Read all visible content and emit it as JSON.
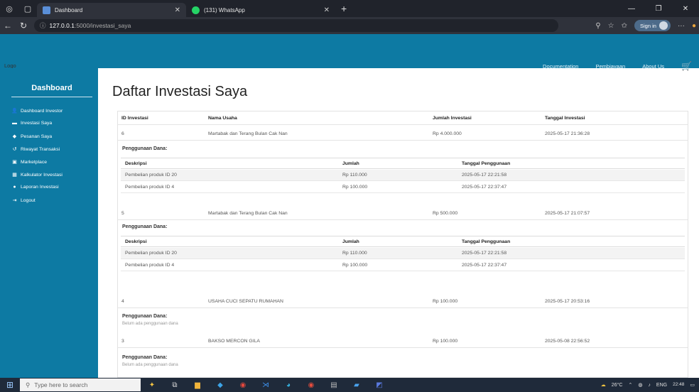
{
  "browser": {
    "tabs": [
      {
        "title": "Dashboard",
        "active": true
      },
      {
        "title": "(131) WhatsApp",
        "active": false
      }
    ],
    "url_host": "127.0.0.1",
    "url_path": ":5000/investasi_saya",
    "signin_label": "Sign in"
  },
  "navbar": {
    "logo": "Logo",
    "links": [
      "Documentation",
      "Pembiayaan",
      "About Us"
    ]
  },
  "sidebar": {
    "title": "Dashboard",
    "items": [
      {
        "label": "Dashboard Investor",
        "icon": "user-icon"
      },
      {
        "label": "Investasi Saya",
        "icon": "card-icon"
      },
      {
        "label": "Pesanan Saya",
        "icon": "box-icon"
      },
      {
        "label": "Riwayat Transaksi",
        "icon": "history-icon"
      },
      {
        "label": "Marketplace",
        "icon": "shop-icon"
      },
      {
        "label": "Kalkulator Investasi",
        "icon": "calculator-icon"
      },
      {
        "label": "Laporan Investasi",
        "icon": "chart-icon"
      },
      {
        "label": "Logout",
        "icon": "logout-icon"
      }
    ]
  },
  "page": {
    "title": "Daftar Investasi Saya",
    "columns": [
      "ID Investasi",
      "Nama Usaha",
      "Jumlah Investasi",
      "Tanggal Investasi"
    ],
    "usage_label": "Penggunaan Dana:",
    "usage_columns": [
      "Deskripsi",
      "Jumlah",
      "Tanggal Penggunaan"
    ],
    "empty_note": "Belum ada penggunaan dana",
    "investments": [
      {
        "id": "6",
        "name": "Martabak dan Terang Bulan Cak Nan",
        "amount": "Rp 4.000.000",
        "date": "2025-05-17 21:36:28",
        "usage": [
          {
            "desc": "Pembelian produk ID 20",
            "amount": "Rp 110.000",
            "date": "2025-05-17 22:21:58"
          },
          {
            "desc": "Pembelian produk ID 4",
            "amount": "Rp 100.000",
            "date": "2025-05-17 22:37:47"
          }
        ]
      },
      {
        "id": "5",
        "name": "Martabak dan Terang Bulan Cak Nan",
        "amount": "Rp 500.000",
        "date": "2025-05-17 21:07:57",
        "usage": [
          {
            "desc": "Pembelian produk ID 20",
            "amount": "Rp 110.000",
            "date": "2025-05-17 22:21:58"
          },
          {
            "desc": "Pembelian produk ID 4",
            "amount": "Rp 100.000",
            "date": "2025-05-17 22:37:47"
          }
        ]
      },
      {
        "id": "4",
        "name": "USAHA CUCI SEPATU RUMAHAN",
        "amount": "Rp 100.000",
        "date": "2025-05-17 20:53:16",
        "usage": []
      },
      {
        "id": "3",
        "name": "BAKSO MERCON GILA",
        "amount": "Rp 100.000",
        "date": "2025-05-08 22:56:52",
        "usage": []
      }
    ]
  },
  "taskbar": {
    "search_placeholder": "Type here to search",
    "weather": "26°C",
    "lang": "ENG",
    "time": "22:48"
  }
}
